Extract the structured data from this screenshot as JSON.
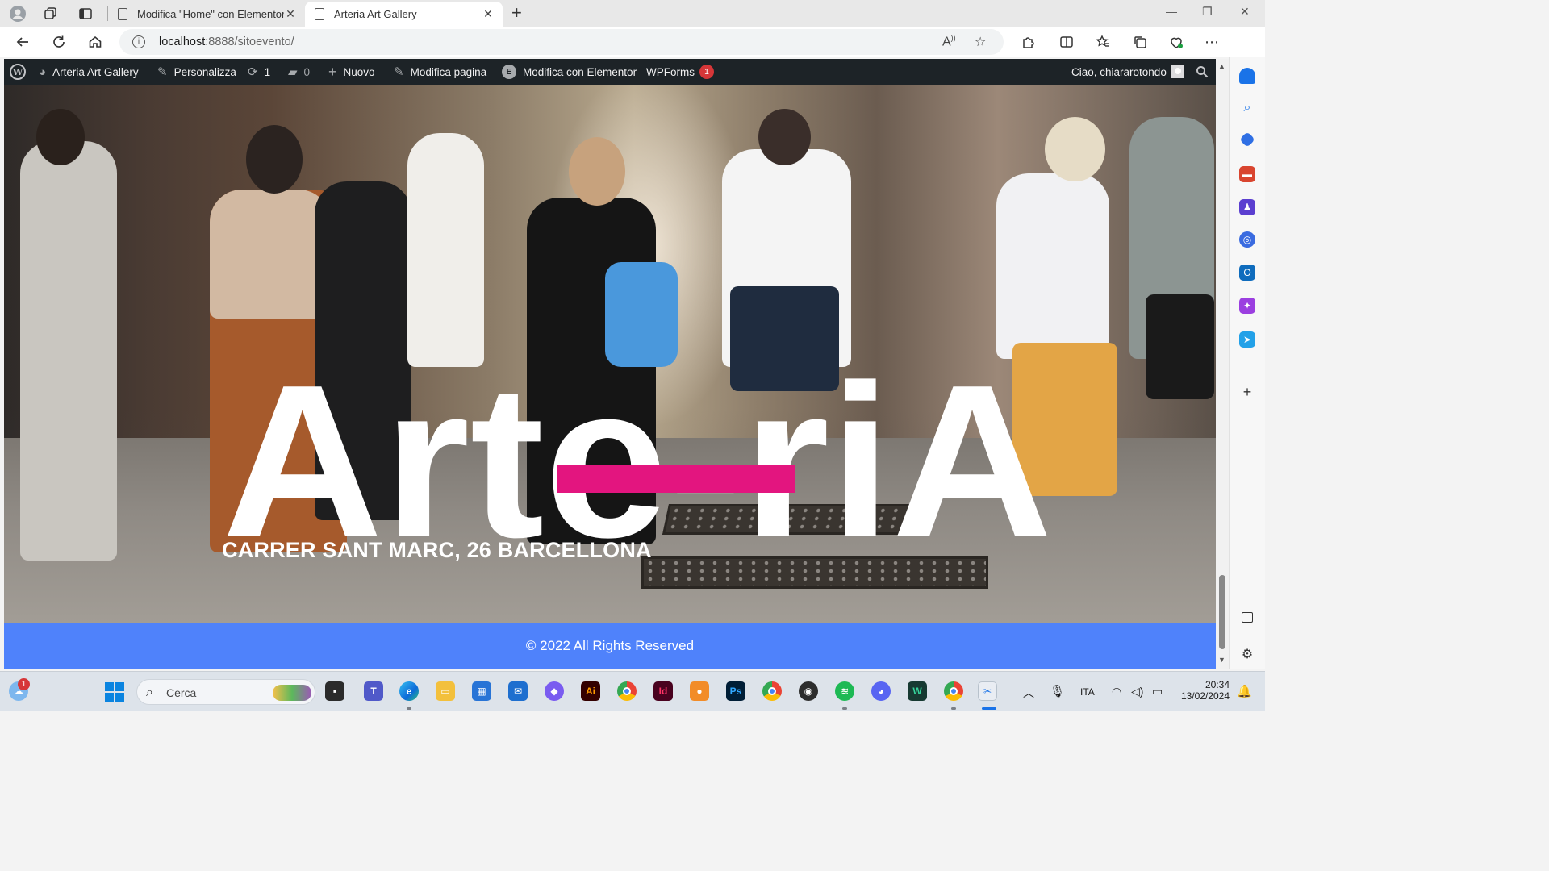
{
  "browser": {
    "tabs": [
      {
        "label": "Modifica \"Home\" con Elementor"
      },
      {
        "label": "Arteria Art Gallery"
      }
    ],
    "address": {
      "host": "localhost",
      "path": ":8888/sitoevento/"
    }
  },
  "wp_admin_bar": {
    "site_name": "Arteria Art Gallery",
    "customize": "Personalizza",
    "updates_count": "1",
    "comments_count": "0",
    "new": "Nuovo",
    "edit_page": "Modifica pagina",
    "edit_elementor": "Modifica con Elementor",
    "wpforms": "WPForms",
    "wpforms_badge": "1",
    "greeting": "Ciao, chiararotondo"
  },
  "hero": {
    "logo_text": "Arte-riA",
    "address": "CARRER SANT MARC, 26 BARCELLONA",
    "accent_color": "#e3157f"
  },
  "footer": {
    "text": "© 2022 All Rights Reserved",
    "color": "#4f82fb"
  },
  "taskbar": {
    "search_placeholder": "Cerca",
    "notification_badge": "1",
    "language": "ITA",
    "time": "20:34",
    "date": "13/02/2024"
  }
}
